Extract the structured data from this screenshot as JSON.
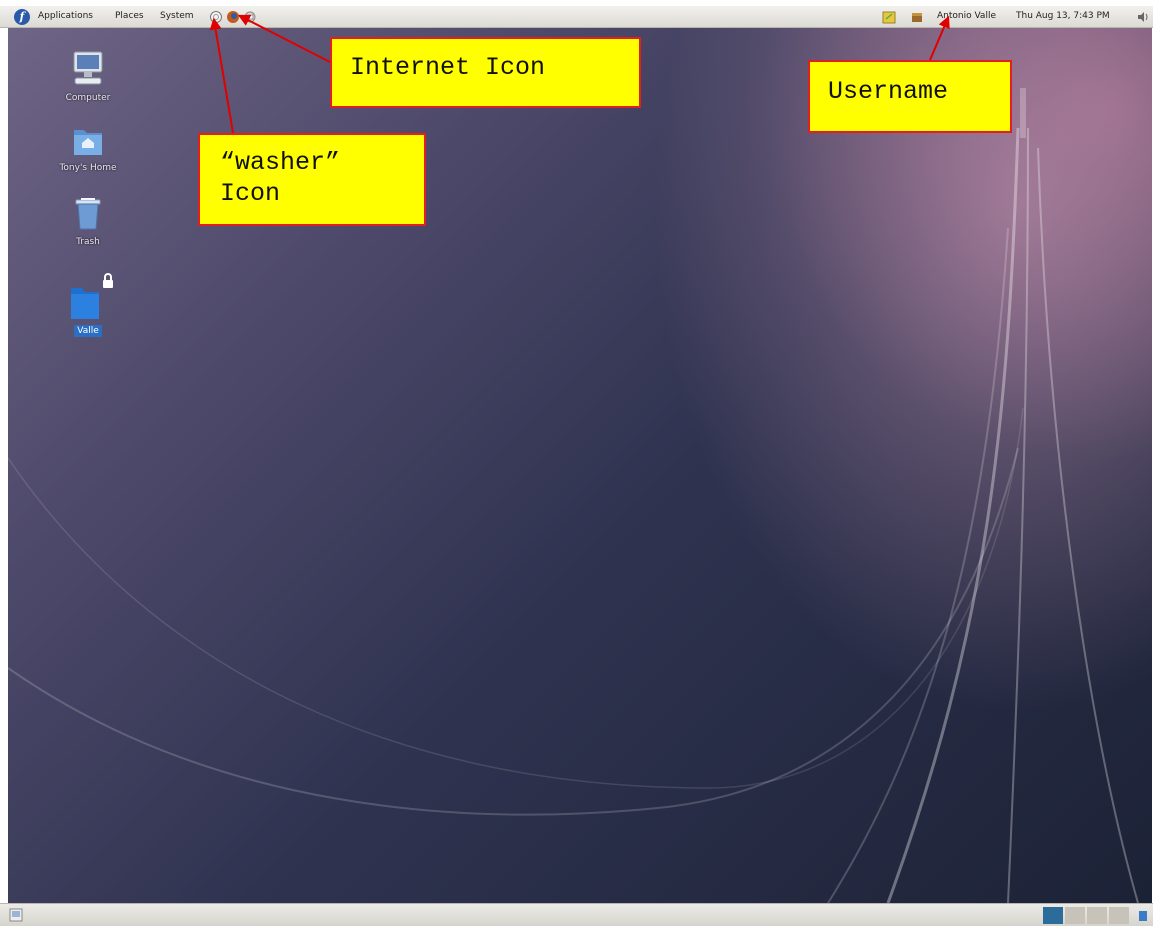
{
  "top_panel": {
    "menus": [
      "Applications",
      "Places",
      "System"
    ],
    "username": "Antonio Valle",
    "datetime": "Thu Aug 13, 7:43 PM"
  },
  "desktop_icons": [
    {
      "label": "Computer",
      "icon": "computer-icon"
    },
    {
      "label": "Tony's Home",
      "icon": "home-folder-icon"
    },
    {
      "label": "Trash",
      "icon": "trash-icon"
    },
    {
      "label": "Valle",
      "icon": "locked-folder-icon"
    }
  ],
  "annotations": {
    "internet_icon": "Internet Icon",
    "username": "Username",
    "washer_line1": "“washer”",
    "washer_line2": "Icon"
  },
  "colors": {
    "callout_fill": "#ffff00",
    "callout_border": "#e02020",
    "arrow": "#e00000",
    "folder_blue": "#1f6fd0"
  }
}
